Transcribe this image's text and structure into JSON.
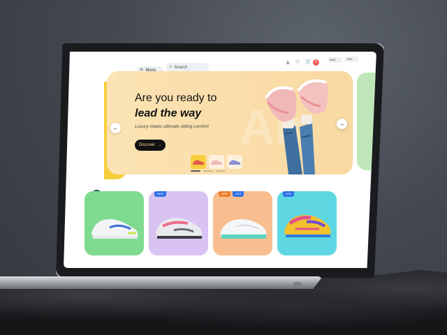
{
  "header": {
    "menu_label": "Menu",
    "search_placeholder": "Search",
    "cart_count": "0",
    "language": "ENG",
    "currency": "USD"
  },
  "hero": {
    "title_line1": "Are you ready to",
    "title_line2": "lead the way",
    "subtitle": "Luxury meets ultimate sitting comfort",
    "cta_label": "Discover",
    "watermark": "Air"
  },
  "products": [
    {
      "badge": "",
      "color": "#7edb8f"
    },
    {
      "badge": "NEW",
      "color": "#d9c3f3"
    },
    {
      "badge": "NEW",
      "badge2": "HOT",
      "color": "#f8be90"
    },
    {
      "badge": "10%",
      "color": "#5fd7e3"
    }
  ],
  "colors": {
    "accent_yellow": "#f7cf3d",
    "hero_bg": "#fbe3b3",
    "badge_blue": "#2f6fe8",
    "badge_orange": "#f07a2a",
    "cart_red": "#ee5a5a"
  }
}
